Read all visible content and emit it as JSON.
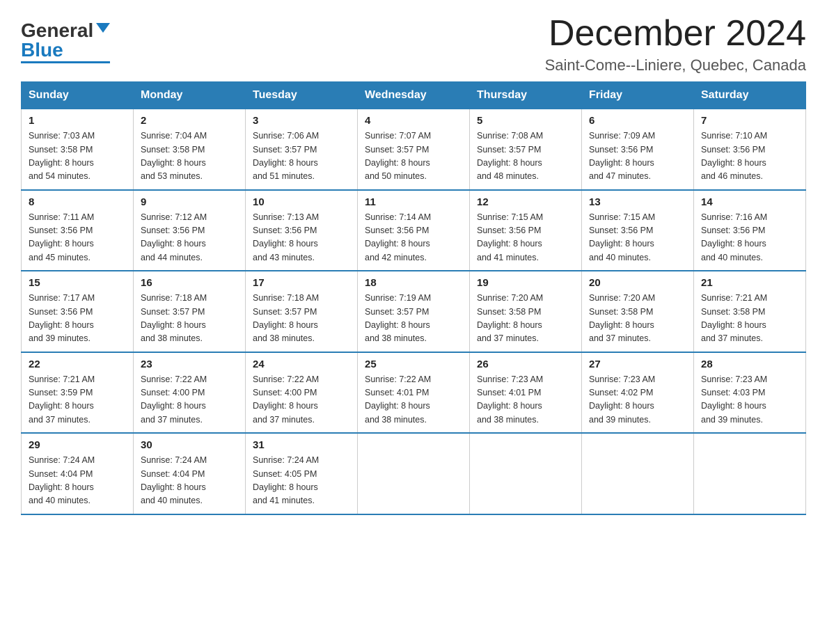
{
  "header": {
    "logo_general": "General",
    "logo_blue": "Blue",
    "title": "December 2024",
    "subtitle": "Saint-Come--Liniere, Quebec, Canada"
  },
  "days_of_week": [
    "Sunday",
    "Monday",
    "Tuesday",
    "Wednesday",
    "Thursday",
    "Friday",
    "Saturday"
  ],
  "weeks": [
    [
      {
        "day": "1",
        "sunrise": "7:03 AM",
        "sunset": "3:58 PM",
        "daylight": "8 hours and 54 minutes."
      },
      {
        "day": "2",
        "sunrise": "7:04 AM",
        "sunset": "3:58 PM",
        "daylight": "8 hours and 53 minutes."
      },
      {
        "day": "3",
        "sunrise": "7:06 AM",
        "sunset": "3:57 PM",
        "daylight": "8 hours and 51 minutes."
      },
      {
        "day": "4",
        "sunrise": "7:07 AM",
        "sunset": "3:57 PM",
        "daylight": "8 hours and 50 minutes."
      },
      {
        "day": "5",
        "sunrise": "7:08 AM",
        "sunset": "3:57 PM",
        "daylight": "8 hours and 48 minutes."
      },
      {
        "day": "6",
        "sunrise": "7:09 AM",
        "sunset": "3:56 PM",
        "daylight": "8 hours and 47 minutes."
      },
      {
        "day": "7",
        "sunrise": "7:10 AM",
        "sunset": "3:56 PM",
        "daylight": "8 hours and 46 minutes."
      }
    ],
    [
      {
        "day": "8",
        "sunrise": "7:11 AM",
        "sunset": "3:56 PM",
        "daylight": "8 hours and 45 minutes."
      },
      {
        "day": "9",
        "sunrise": "7:12 AM",
        "sunset": "3:56 PM",
        "daylight": "8 hours and 44 minutes."
      },
      {
        "day": "10",
        "sunrise": "7:13 AM",
        "sunset": "3:56 PM",
        "daylight": "8 hours and 43 minutes."
      },
      {
        "day": "11",
        "sunrise": "7:14 AM",
        "sunset": "3:56 PM",
        "daylight": "8 hours and 42 minutes."
      },
      {
        "day": "12",
        "sunrise": "7:15 AM",
        "sunset": "3:56 PM",
        "daylight": "8 hours and 41 minutes."
      },
      {
        "day": "13",
        "sunrise": "7:15 AM",
        "sunset": "3:56 PM",
        "daylight": "8 hours and 40 minutes."
      },
      {
        "day": "14",
        "sunrise": "7:16 AM",
        "sunset": "3:56 PM",
        "daylight": "8 hours and 40 minutes."
      }
    ],
    [
      {
        "day": "15",
        "sunrise": "7:17 AM",
        "sunset": "3:56 PM",
        "daylight": "8 hours and 39 minutes."
      },
      {
        "day": "16",
        "sunrise": "7:18 AM",
        "sunset": "3:57 PM",
        "daylight": "8 hours and 38 minutes."
      },
      {
        "day": "17",
        "sunrise": "7:18 AM",
        "sunset": "3:57 PM",
        "daylight": "8 hours and 38 minutes."
      },
      {
        "day": "18",
        "sunrise": "7:19 AM",
        "sunset": "3:57 PM",
        "daylight": "8 hours and 38 minutes."
      },
      {
        "day": "19",
        "sunrise": "7:20 AM",
        "sunset": "3:58 PM",
        "daylight": "8 hours and 37 minutes."
      },
      {
        "day": "20",
        "sunrise": "7:20 AM",
        "sunset": "3:58 PM",
        "daylight": "8 hours and 37 minutes."
      },
      {
        "day": "21",
        "sunrise": "7:21 AM",
        "sunset": "3:58 PM",
        "daylight": "8 hours and 37 minutes."
      }
    ],
    [
      {
        "day": "22",
        "sunrise": "7:21 AM",
        "sunset": "3:59 PM",
        "daylight": "8 hours and 37 minutes."
      },
      {
        "day": "23",
        "sunrise": "7:22 AM",
        "sunset": "4:00 PM",
        "daylight": "8 hours and 37 minutes."
      },
      {
        "day": "24",
        "sunrise": "7:22 AM",
        "sunset": "4:00 PM",
        "daylight": "8 hours and 37 minutes."
      },
      {
        "day": "25",
        "sunrise": "7:22 AM",
        "sunset": "4:01 PM",
        "daylight": "8 hours and 38 minutes."
      },
      {
        "day": "26",
        "sunrise": "7:23 AM",
        "sunset": "4:01 PM",
        "daylight": "8 hours and 38 minutes."
      },
      {
        "day": "27",
        "sunrise": "7:23 AM",
        "sunset": "4:02 PM",
        "daylight": "8 hours and 39 minutes."
      },
      {
        "day": "28",
        "sunrise": "7:23 AM",
        "sunset": "4:03 PM",
        "daylight": "8 hours and 39 minutes."
      }
    ],
    [
      {
        "day": "29",
        "sunrise": "7:24 AM",
        "sunset": "4:04 PM",
        "daylight": "8 hours and 40 minutes."
      },
      {
        "day": "30",
        "sunrise": "7:24 AM",
        "sunset": "4:04 PM",
        "daylight": "8 hours and 40 minutes."
      },
      {
        "day": "31",
        "sunrise": "7:24 AM",
        "sunset": "4:05 PM",
        "daylight": "8 hours and 41 minutes."
      },
      null,
      null,
      null,
      null
    ]
  ],
  "labels": {
    "sunrise": "Sunrise:",
    "sunset": "Sunset:",
    "daylight": "Daylight:"
  }
}
